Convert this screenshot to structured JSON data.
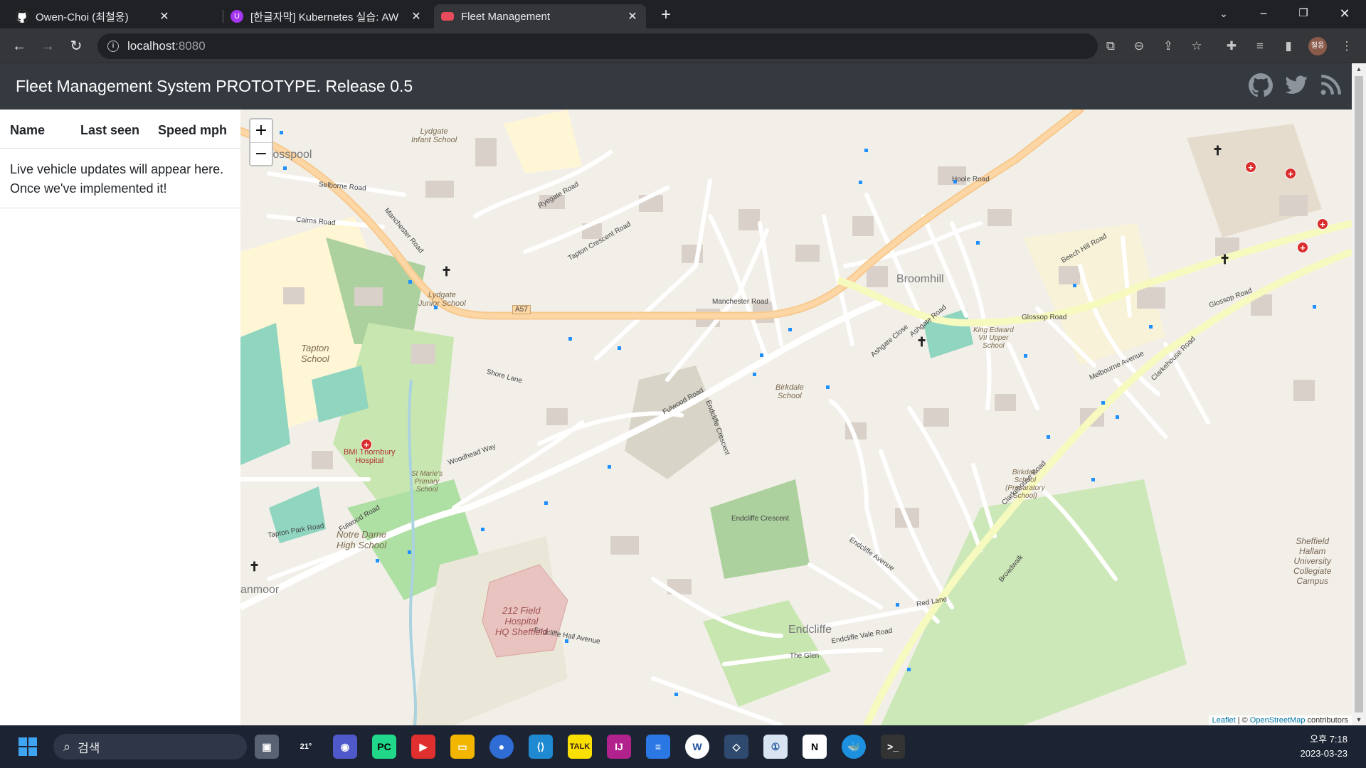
{
  "browser": {
    "tabs": [
      {
        "title": "Owen-Choi (최철웅)",
        "active": false
      },
      {
        "title": "[한글자막] Kubernetes 실습: AW",
        "active": false
      },
      {
        "title": "Fleet Management",
        "active": true
      }
    ],
    "url_host": "localhost",
    "url_port": ":8080",
    "profile_initials": "철웅"
  },
  "app": {
    "title": "Fleet Management System PROTOTYPE. Release 0.5",
    "social_icons": [
      "github-icon",
      "twitter-icon",
      "rss-icon"
    ]
  },
  "sidebar": {
    "columns": [
      "Name",
      "Last seen",
      "Speed mph"
    ],
    "message": "Live vehicle updates will appear here. Once we've implemented it!"
  },
  "map": {
    "zoom_in": "+",
    "zoom_out": "−",
    "attribution_leaflet": "Leaflet",
    "attribution_osm": "OpenStreetMap",
    "attribution_rest": "contributors",
    "labels": {
      "broomhill": "Broomhill",
      "endcliffe": "Endcliffe",
      "crosspool": "rosspool",
      "ranmoor": "anmoor",
      "manchester_road_1": "Manchester Road",
      "manchester_road_2": "Manchester Road",
      "a57": "A57",
      "glossop_road": "Glossop Road",
      "glossop_road_2": "Glossop Road",
      "clarkehouse_road": "Clarkehouse Road",
      "clarkehouse_road_2": "Clarkehouse Road",
      "fulwood_road": "Fulwood Road",
      "fulwood_road_2": "Fulwood Road",
      "shore_lane": "Shore Lane",
      "woodhead_way": "Woodhead Way",
      "tapton_crescent_road": "Tapton Crescent Road",
      "ryegate_road": "Ryegate Road",
      "selborne_road": "Selborne Road",
      "cairns_road": "Cairns Road",
      "hoole_road": "Hoole Road",
      "ashgate_close": "Ashgate Close",
      "ashgate_road": "Ashgate Road",
      "melbourne_avenue": "Melbourne Avenue",
      "endcliffe_crescent": "Endcliffe Crescent",
      "endcliffe_avenue": "Endcliffe Avenue",
      "endcliffe_vale_road": "Endcliffe Vale Road",
      "endcliffe_hall_avenue": "Endcliffe Hall Avenue",
      "red_lane": "Red Lane",
      "the_glen": "The Glen",
      "tapton_park_road": "Tapton Park Road",
      "beech_hill_road": "Beech Hill Road",
      "lydgate_infant": "Lydgate\nInfant School",
      "lydgate_junior": "Lydgate\nJunior School",
      "tapton_school": "Tapton\nSchool",
      "birkdale_school": "Birkdale\nSchool",
      "birkdale_prep": "Birkdale\nSchool\n(Preparatory\nSchool)",
      "king_edward": "King Edward\nVII Upper\nSchool",
      "st_maries": "St Marie's\nPrimary\nSchool",
      "notre_dame": "Notre Dame\nHigh School",
      "bmi_hospital": "BMI Thornbury\nHospital",
      "field_hospital": "212 Field\nHospital\nHQ Sheffield",
      "sheffield_hallam": "Sheffield\nHallam\nUniversity\nCollegiate\nCampus",
      "broadwalk": "Broadwalk"
    }
  },
  "taskbar": {
    "search_label": "검색",
    "weather": "21°",
    "time": "오후 7:18",
    "date": "2023-03-23"
  }
}
